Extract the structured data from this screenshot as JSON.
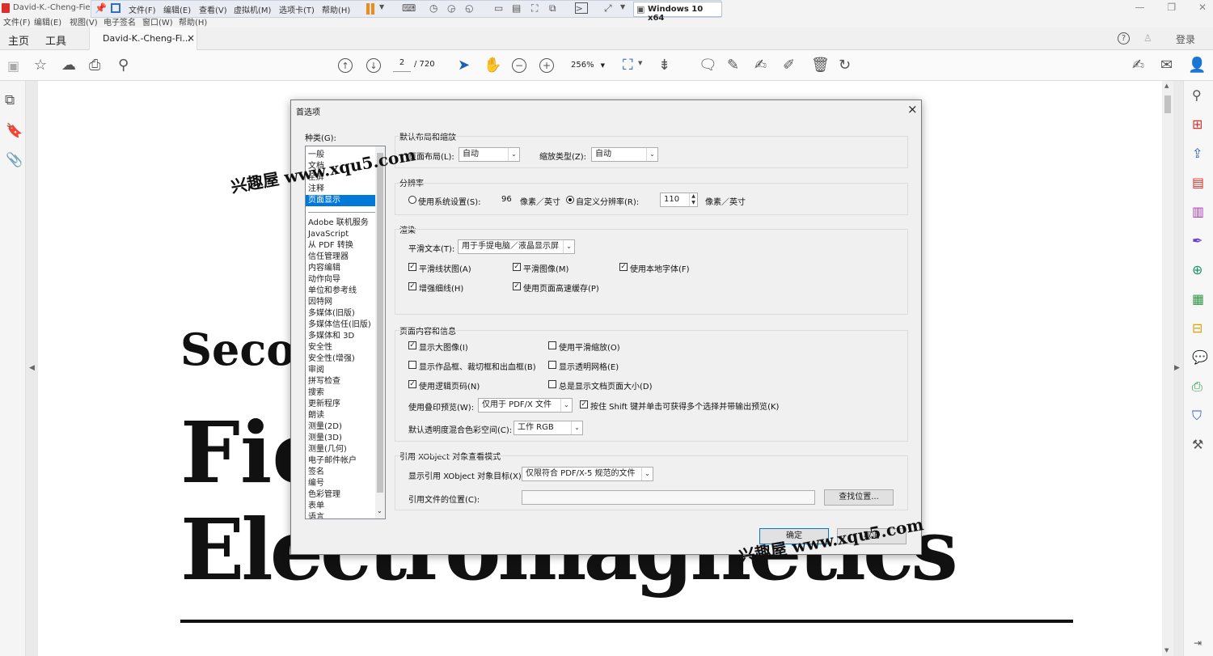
{
  "window": {
    "app_tab_title": "David-K.-Cheng-Field",
    "vm_menu": [
      "文件(F)",
      "编辑(E)",
      "查看(V)",
      "虚拟机(M)",
      "选项卡(T)",
      "帮助(H)"
    ],
    "vm_tab": "Windows 10 x64"
  },
  "old_menu": [
    "文件(F)",
    "编辑(E)",
    "视图(V)",
    "电子签名",
    "窗口(W)",
    "帮助(H)"
  ],
  "tabs": {
    "home": "主页",
    "tools": "工具",
    "doc": "David-K.-Cheng-Fi...",
    "close": "×",
    "login": "登录"
  },
  "toolbar": {
    "page_current": "2",
    "page_total": "/ 720",
    "zoom": "256%"
  },
  "page": {
    "title_line1": "Secon",
    "title_line2": "Fie",
    "title_line3": "Electromagnetics"
  },
  "dialog": {
    "title": "首选项",
    "close": "×",
    "category_label": "种类(G):",
    "categories_top": [
      "一般",
      "文档",
      "全屏",
      "注释",
      "页面显示"
    ],
    "categories": [
      "Adobe 联机服务",
      "JavaScript",
      "从 PDF 转换",
      "信任管理器",
      "内容编辑",
      "动作向导",
      "单位和参考线",
      "因特网",
      "多媒体(旧版)",
      "多媒体信任(旧版)",
      "多媒体和 3D",
      "安全性",
      "安全性(增强)",
      "审阅",
      "拼写检查",
      "搜索",
      "更新程序",
      "朗读",
      "测量(2D)",
      "测量(3D)",
      "测量(几何)",
      "电子邮件帐户",
      "签名",
      "编号",
      "色彩管理",
      "表单",
      "语言"
    ],
    "layout": {
      "group": "默认布局和缩放",
      "page_layout_label": "页面布局(L):",
      "page_layout_value": "自动",
      "zoom_label": "缩放类型(Z):",
      "zoom_value": "自动"
    },
    "resolution": {
      "group": "分辨率",
      "system": "使用系统设置(S):",
      "system_value": "96",
      "unit": "像素／英寸",
      "custom": "自定义分辨率(R):",
      "custom_value": "110",
      "custom_unit": "像素／英寸"
    },
    "render": {
      "group": "渲染",
      "smooth_text_label": "平滑文本(T):",
      "smooth_text_value": "用于手提电脑／液晶显示屏",
      "cb_lineart": "平滑线状图(A)",
      "cb_images": "平滑图像(M)",
      "cb_localfonts": "使用本地字体(F)",
      "cb_thin": "增强细线(H)",
      "cb_cache": "使用页面高速缓存(P)"
    },
    "content": {
      "group": "页面内容和信息",
      "cb_large_images": "显示大图像(I)",
      "cb_smooth_zoom": "使用平滑缩放(O)",
      "cb_art_trim": "显示作品框、裁切框和出血框(B)",
      "cb_transparency_grid": "显示透明网格(E)",
      "cb_logical_page": "使用逻辑页码(N)",
      "cb_doc_page_size": "总是显示文档页面大小(D)",
      "overprint_label": "使用叠印预览(W):",
      "overprint_value": "仅用于 PDF/X 文件",
      "cb_shift": "按住 Shift 键并单击可获得多个选择并带输出预览(K)",
      "blend_label": "默认透明度混合色彩空间(C):",
      "blend_value": "工作 RGB"
    },
    "xobject": {
      "group": "引用 XObject 对象查看模式",
      "target_label": "显示引用 XObject 对象目标(X):",
      "target_value": "仅限符合 PDF/X-5 规范的文件",
      "location_label": "引用文件的位置(C):",
      "browse": "查找位置..."
    },
    "ok": "确定",
    "cancel": "取消"
  },
  "watermark": {
    "text1": "兴趣屋 www.xqu5.com",
    "text2": "兴趣屋 www.xqu5.com"
  }
}
